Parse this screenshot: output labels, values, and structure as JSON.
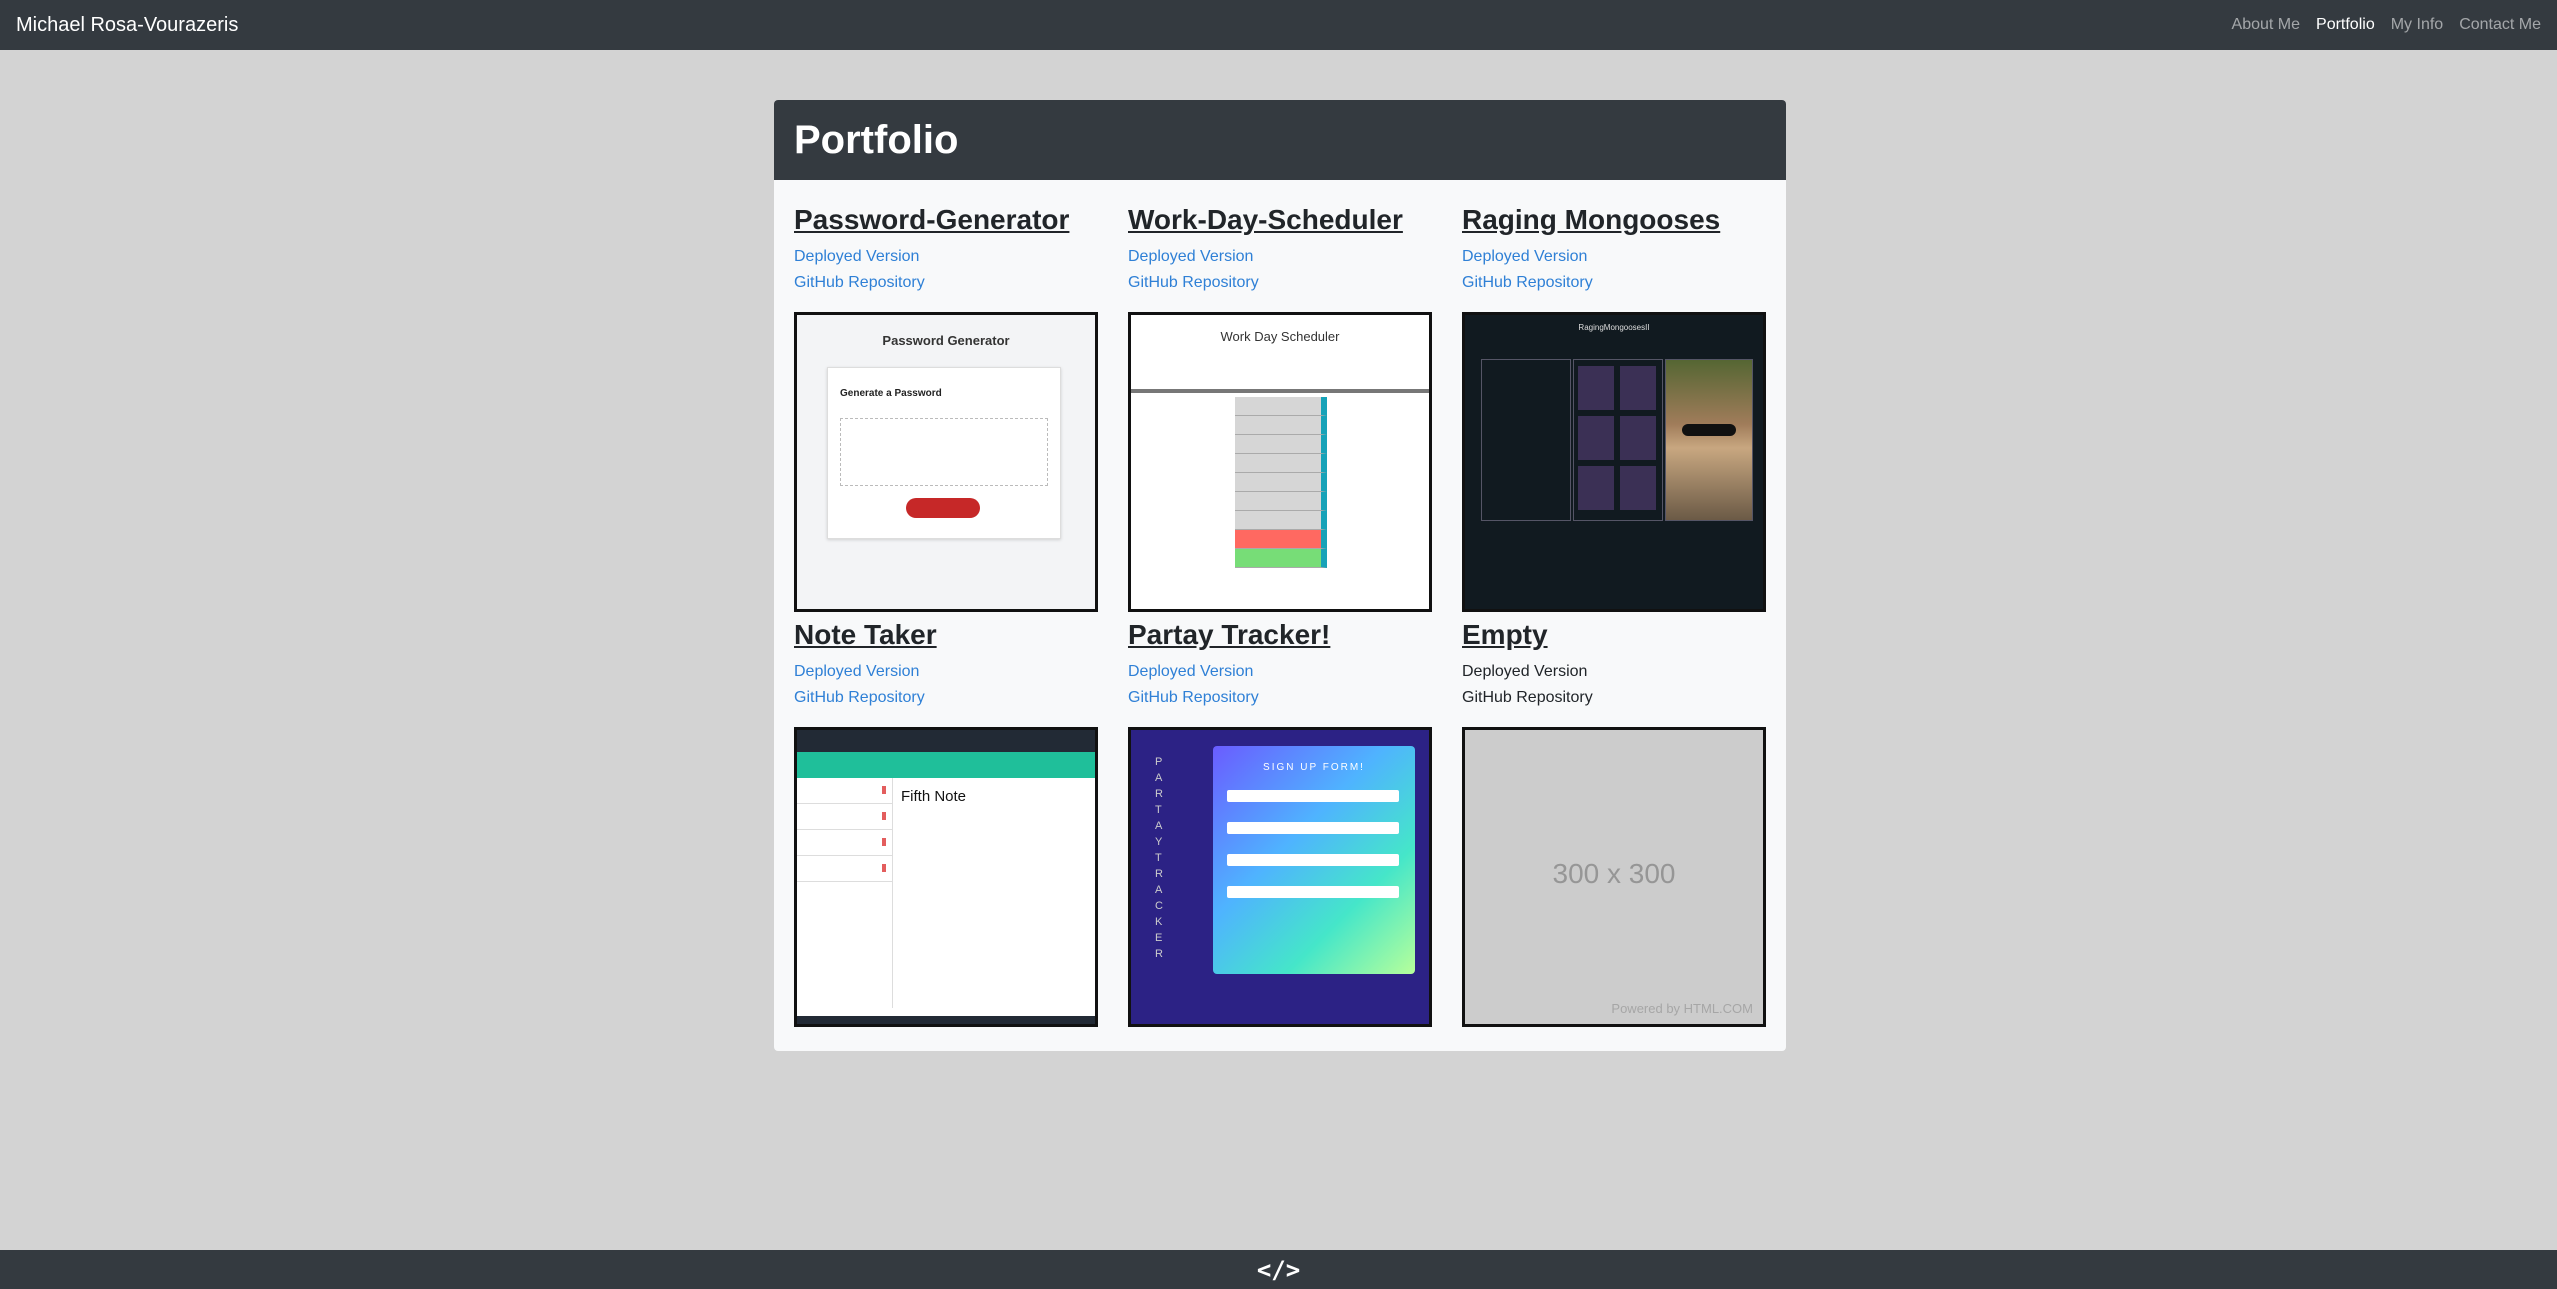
{
  "navbar": {
    "brand": "Michael Rosa-Vourazeris",
    "links": [
      {
        "label": "About Me",
        "active": false
      },
      {
        "label": "Portfolio",
        "active": true
      },
      {
        "label": "My Info",
        "active": false
      },
      {
        "label": "Contact Me",
        "active": false
      }
    ]
  },
  "portfolio": {
    "title": "Portfolio",
    "projects": [
      {
        "title": "Password-Generator",
        "deployed": "Deployed Version",
        "repo": "GitHub Repository",
        "thumb": {
          "heading": "Password Generator",
          "subheading": "Generate a Password"
        }
      },
      {
        "title": "Work-Day-Scheduler",
        "deployed": "Deployed Version",
        "repo": "GitHub Repository",
        "thumb": {
          "heading": "Work Day Scheduler"
        }
      },
      {
        "title": "Raging Mongooses",
        "deployed": "Deployed Version",
        "repo": "GitHub Repository",
        "thumb": {
          "heading": "RagingMongoosesII"
        }
      },
      {
        "title": "Note Taker",
        "deployed": "Deployed Version",
        "repo": "GitHub Repository",
        "thumb": {
          "heading": "Fifth Note"
        }
      },
      {
        "title": "Partay Tracker!",
        "deployed": "Deployed Version",
        "repo": "GitHub Repository",
        "thumb": {
          "heading": "SIGN UP FORM!",
          "side": "PARTAY TRACKER"
        }
      },
      {
        "title": "Empty",
        "deployed": "Deployed Version",
        "repo": "GitHub Repository",
        "thumb": {
          "placeholder": "300 x 300",
          "powered": "Powered by HTML.COM"
        }
      }
    ]
  },
  "footer": {
    "icon": "code-icon",
    "glyph": "</>"
  },
  "colors": {
    "background": "#d3d3d3",
    "dark": "#343a40",
    "link": "#2f80d6",
    "card": "#f8f9fa"
  }
}
